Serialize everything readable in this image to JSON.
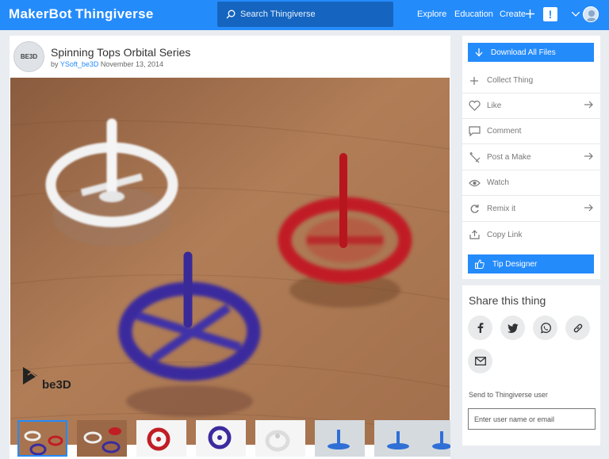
{
  "nav": {
    "logo_primary": "MakerBot",
    "logo_secondary": "Thingiverse",
    "search_placeholder": "Search Thingiverse",
    "links": [
      "Explore",
      "Education",
      "Create"
    ],
    "alert_glyph": "!",
    "brand_color": "#248bfb"
  },
  "thing": {
    "badge_text": "BE3D",
    "title": "Spinning Tops Orbital Series",
    "by_prefix": "by",
    "author": "YSoft_be3D",
    "date": "November 13, 2014",
    "watermark": "be3D"
  },
  "gallery": {
    "thumbnail_count": 8,
    "selected_index": 0
  },
  "actions": {
    "download_label": "Download All Files",
    "items": [
      {
        "label": "Collect Thing",
        "icon": "plus-icon",
        "arrow": false
      },
      {
        "label": "Like",
        "icon": "heart-icon",
        "arrow": true
      },
      {
        "label": "Comment",
        "icon": "comment-icon",
        "arrow": false
      },
      {
        "label": "Post a Make",
        "icon": "make-icon",
        "arrow": true
      },
      {
        "label": "Watch",
        "icon": "eye-icon",
        "arrow": false
      },
      {
        "label": "Remix it",
        "icon": "remix-icon",
        "arrow": true
      },
      {
        "label": "Copy Link",
        "icon": "share-icon",
        "arrow": false
      }
    ],
    "tip_label": "Tip Designer"
  },
  "share": {
    "title": "Share this thing",
    "buttons": [
      "facebook-icon",
      "twitter-icon",
      "whatsapp-icon",
      "link-icon",
      "mail-icon"
    ],
    "send_label": "Send to Thingiverse user",
    "input_placeholder": "Enter user name or email"
  }
}
